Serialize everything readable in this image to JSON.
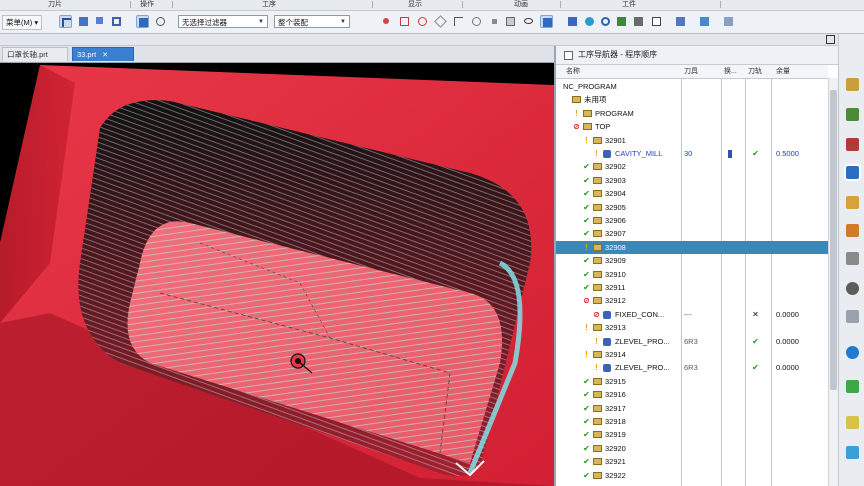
{
  "toolbar_groups": [
    "刀片",
    "操作",
    "工序",
    "显示",
    "动画",
    "工件"
  ],
  "toolbar": {
    "menu_label": "菜单(M) ▾",
    "filter_select": "无选择过滤器",
    "assembly_select": "整个装配"
  },
  "tabs": [
    {
      "label": "口罩长轴.prt",
      "active": false
    },
    {
      "label": "33.prt",
      "active": true
    }
  ],
  "navigator": {
    "title": "工序导航器 - 程序顺序",
    "columns": [
      "名称",
      "刀具",
      "换...",
      "刀轨",
      "余量"
    ],
    "rows": [
      {
        "indent": 0,
        "icons": [],
        "name": "NC_PROGRAM",
        "tool": "",
        "change": "",
        "path": "",
        "stock": "",
        "selected": false
      },
      {
        "indent": 1,
        "icons": [
          "folder"
        ],
        "name": "未用项",
        "tool": "",
        "change": "",
        "path": "",
        "stock": "",
        "selected": false
      },
      {
        "indent": 1,
        "icons": [
          "warn",
          "folder"
        ],
        "name": "PROGRAM",
        "tool": "",
        "change": "",
        "path": "",
        "stock": "",
        "selected": false
      },
      {
        "indent": 1,
        "icons": [
          "stop",
          "folder"
        ],
        "name": "TOP",
        "tool": "",
        "change": "",
        "path": "",
        "stock": "",
        "selected": false
      },
      {
        "indent": 2,
        "icons": [
          "warn",
          "folder"
        ],
        "name": "32901",
        "tool": "",
        "change": "",
        "path": "",
        "stock": "",
        "selected": false
      },
      {
        "indent": 3,
        "icons": [
          "warn",
          "tool"
        ],
        "name": "CAVITY_MILL",
        "tool": "30",
        "change": "bar",
        "path": "check",
        "stock": "0.5000",
        "selected": false,
        "blue": true
      },
      {
        "indent": 2,
        "icons": [
          "check",
          "folder"
        ],
        "name": "32902",
        "tool": "",
        "change": "",
        "path": "",
        "stock": "",
        "selected": false
      },
      {
        "indent": 2,
        "icons": [
          "check",
          "folder"
        ],
        "name": "32903",
        "tool": "",
        "change": "",
        "path": "",
        "stock": "",
        "selected": false
      },
      {
        "indent": 2,
        "icons": [
          "check",
          "folder"
        ],
        "name": "32904",
        "tool": "",
        "change": "",
        "path": "",
        "stock": "",
        "selected": false
      },
      {
        "indent": 2,
        "icons": [
          "check",
          "folder"
        ],
        "name": "32905",
        "tool": "",
        "change": "",
        "path": "",
        "stock": "",
        "selected": false
      },
      {
        "indent": 2,
        "icons": [
          "check",
          "folder"
        ],
        "name": "32906",
        "tool": "",
        "change": "",
        "path": "",
        "stock": "",
        "selected": false
      },
      {
        "indent": 2,
        "icons": [
          "check",
          "folder"
        ],
        "name": "32907",
        "tool": "",
        "change": "",
        "path": "",
        "stock": "",
        "selected": false
      },
      {
        "indent": 2,
        "icons": [
          "warn",
          "folder"
        ],
        "name": "32908",
        "tool": "",
        "change": "",
        "path": "",
        "stock": "",
        "selected": true
      },
      {
        "indent": 2,
        "icons": [
          "check",
          "folder"
        ],
        "name": "32909",
        "tool": "",
        "change": "",
        "path": "",
        "stock": "",
        "selected": false
      },
      {
        "indent": 2,
        "icons": [
          "check",
          "folder"
        ],
        "name": "32910",
        "tool": "",
        "change": "",
        "path": "",
        "stock": "",
        "selected": false
      },
      {
        "indent": 2,
        "icons": [
          "check",
          "folder"
        ],
        "name": "32911",
        "tool": "",
        "change": "",
        "path": "",
        "stock": "",
        "selected": false
      },
      {
        "indent": 2,
        "icons": [
          "stop",
          "folder"
        ],
        "name": "32912",
        "tool": "",
        "change": "",
        "path": "",
        "stock": "",
        "selected": false
      },
      {
        "indent": 3,
        "icons": [
          "stop",
          "tool"
        ],
        "name": "FIXED_CON...",
        "tool": "---",
        "change": "",
        "path": "x",
        "stock": "0.0000",
        "selected": false
      },
      {
        "indent": 2,
        "icons": [
          "warn",
          "folder"
        ],
        "name": "32913",
        "tool": "",
        "change": "",
        "path": "",
        "stock": "",
        "selected": false
      },
      {
        "indent": 3,
        "icons": [
          "warn",
          "tool"
        ],
        "name": "ZLEVEL_PRO...",
        "tool": "6R3",
        "change": "",
        "path": "check",
        "stock": "0.0000",
        "selected": false
      },
      {
        "indent": 2,
        "icons": [
          "warn",
          "folder"
        ],
        "name": "32914",
        "tool": "",
        "change": "",
        "path": "",
        "stock": "",
        "selected": false
      },
      {
        "indent": 3,
        "icons": [
          "warn",
          "tool"
        ],
        "name": "ZLEVEL_PRO...",
        "tool": "6R3",
        "change": "",
        "path": "check",
        "stock": "0.0000",
        "selected": false
      },
      {
        "indent": 2,
        "icons": [
          "check",
          "folder"
        ],
        "name": "32915",
        "tool": "",
        "change": "",
        "path": "",
        "stock": "",
        "selected": false
      },
      {
        "indent": 2,
        "icons": [
          "check",
          "folder"
        ],
        "name": "32916",
        "tool": "",
        "change": "",
        "path": "",
        "stock": "",
        "selected": false
      },
      {
        "indent": 2,
        "icons": [
          "check",
          "folder"
        ],
        "name": "32917",
        "tool": "",
        "change": "",
        "path": "",
        "stock": "",
        "selected": false
      },
      {
        "indent": 2,
        "icons": [
          "check",
          "folder"
        ],
        "name": "32918",
        "tool": "",
        "change": "",
        "path": "",
        "stock": "",
        "selected": false
      },
      {
        "indent": 2,
        "icons": [
          "check",
          "folder"
        ],
        "name": "32919",
        "tool": "",
        "change": "",
        "path": "",
        "stock": "",
        "selected": false
      },
      {
        "indent": 2,
        "icons": [
          "check",
          "folder"
        ],
        "name": "32920",
        "tool": "",
        "change": "",
        "path": "",
        "stock": "",
        "selected": false
      },
      {
        "indent": 2,
        "icons": [
          "check",
          "folder"
        ],
        "name": "32921",
        "tool": "",
        "change": "",
        "path": "",
        "stock": "",
        "selected": false
      },
      {
        "indent": 2,
        "icons": [
          "check",
          "folder"
        ],
        "name": "32922",
        "tool": "",
        "change": "",
        "path": "",
        "stock": "",
        "selected": false
      }
    ]
  },
  "colors": {
    "part_red": "#e0283a",
    "toolpath_cyan": "#7fe0e6",
    "selection_blue": "#3a88b8",
    "check_green": "#1b9a1b",
    "warn_yellow": "#e2a800"
  }
}
